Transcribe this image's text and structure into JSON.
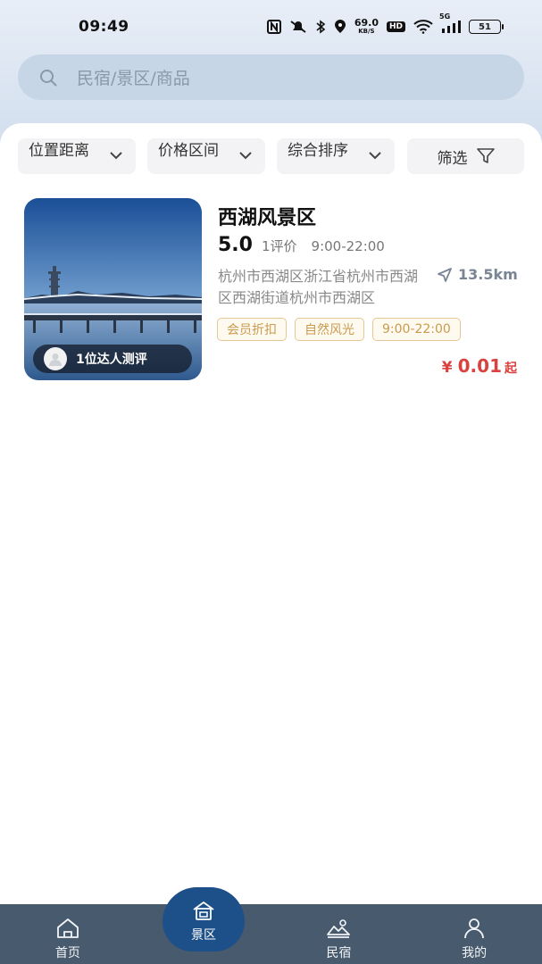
{
  "status_bar": {
    "time": "09:49",
    "net_speed": "69.0",
    "net_unit": "KB/S",
    "hd": "HD",
    "net_type": "5G",
    "battery": "51"
  },
  "search": {
    "placeholder": "民宿/景区/商品"
  },
  "filters": {
    "distance": "位置距离",
    "price": "价格区间",
    "sort": "综合排序",
    "screen": "筛选"
  },
  "listing": {
    "title": "西湖风景区",
    "rating": "5.0",
    "review_count": "1评价",
    "hours": "9:00-22:00",
    "address": "杭州市西湖区浙江省杭州市西湖区西湖街道杭州市西湖区",
    "distance": "13.5km",
    "reviewer_badge": "1位达人测评",
    "tags": [
      "会员折扣",
      "自然风光",
      "9:00-22:00"
    ],
    "price_symbol": "¥",
    "price": "0.01",
    "price_suffix": "起"
  },
  "tab_bar": {
    "home": "首页",
    "scenic": "景区",
    "homestay": "民宿",
    "mine": "我的",
    "active": "景区"
  },
  "colors": {
    "accent": "#1d4f89",
    "tab_bar": "#485a6d",
    "price": "#d9433f",
    "tag_border": "#e3c896",
    "tag_text": "#c89b4e"
  }
}
